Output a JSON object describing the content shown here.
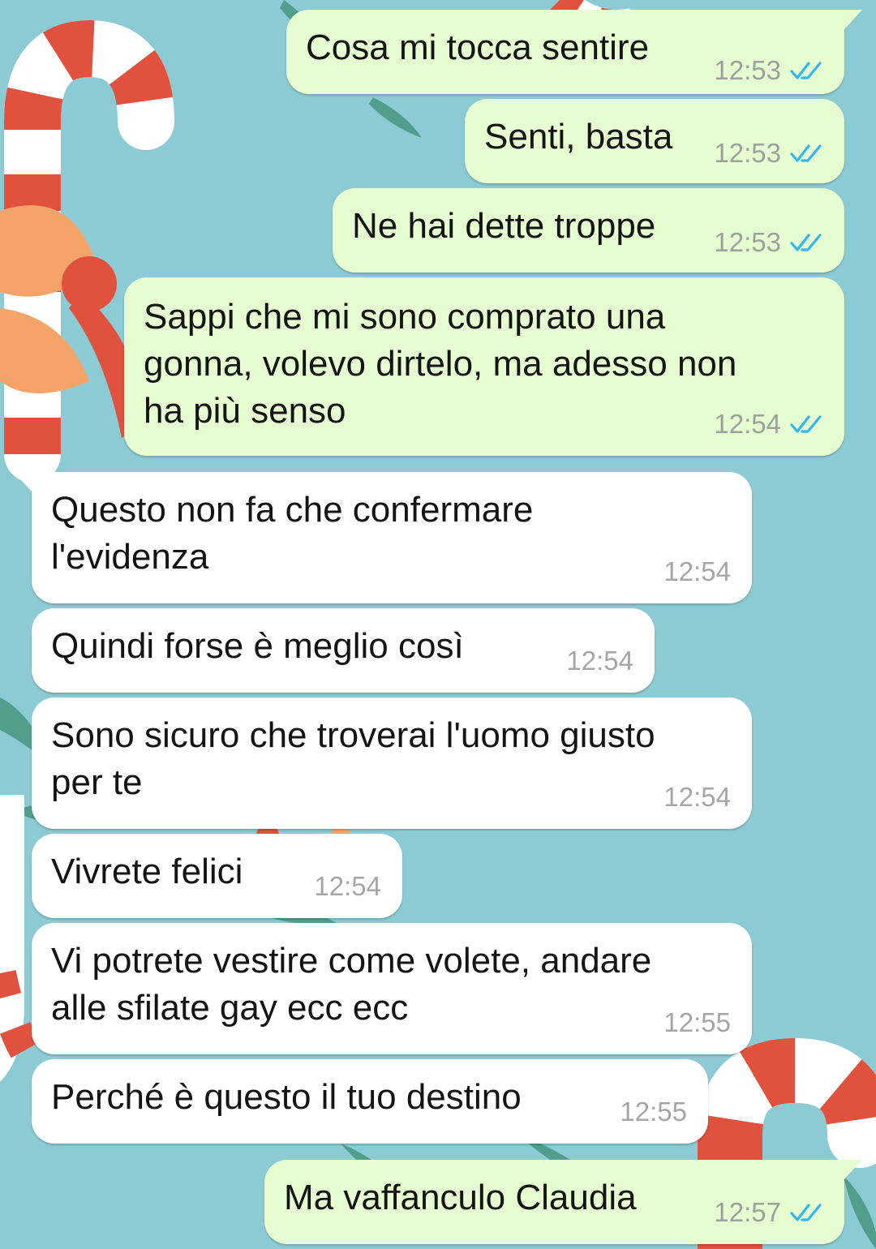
{
  "colors": {
    "wallpaper": "#8ccbd3",
    "outgoing_bubble": "#e6fdd2",
    "incoming_bubble": "#ffffff",
    "read_ticks": "#34b7f1"
  },
  "messages": [
    {
      "direction": "outgoing",
      "text": "Cosa mi tocca sentire",
      "time": "12:53",
      "status": "read"
    },
    {
      "direction": "outgoing",
      "text": "Senti, basta",
      "time": "12:53",
      "status": "read"
    },
    {
      "direction": "outgoing",
      "text": "Ne hai dette troppe",
      "time": "12:53",
      "status": "read"
    },
    {
      "direction": "outgoing",
      "text": "Sappi che mi sono comprato una\ngonna, volevo dirtelo, ma adesso non\nha più senso",
      "time": "12:54",
      "status": "read"
    },
    {
      "direction": "incoming",
      "text": "Questo non fa che confermare\nl'evidenza",
      "time": "12:54"
    },
    {
      "direction": "incoming",
      "text": "Quindi forse è meglio così",
      "time": "12:54"
    },
    {
      "direction": "incoming",
      "text": "Sono sicuro che troverai l'uomo giusto\nper te",
      "time": "12:54"
    },
    {
      "direction": "incoming",
      "text": "Vivrete felici",
      "time": "12:54"
    },
    {
      "direction": "incoming",
      "text": "Vi potrete vestire come volete, andare\nalle sfilate gay ecc ecc",
      "time": "12:55"
    },
    {
      "direction": "incoming",
      "text": "Perché è questo il tuo destino",
      "time": "12:55"
    },
    {
      "direction": "outgoing",
      "text": "Ma vaffanculo Claudia",
      "time": "12:57",
      "status": "read"
    }
  ]
}
